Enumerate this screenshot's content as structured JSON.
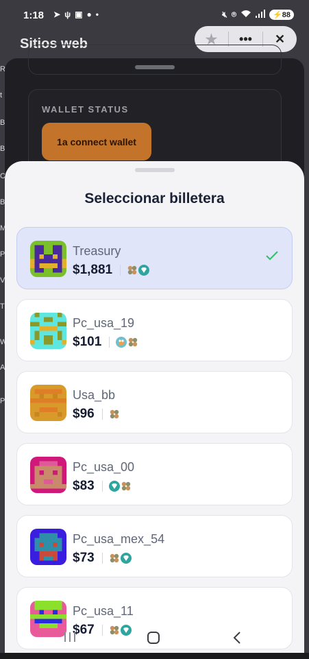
{
  "status_bar": {
    "time": "1:18",
    "battery": "88",
    "left_icons": [
      "location-icon",
      "usb-icon",
      "sim-icon",
      "chat-icon",
      "dot-icon"
    ],
    "right_icons": [
      "mute-icon",
      "location-icon",
      "wifi-icon",
      "signal-icon"
    ]
  },
  "browser": {
    "title": "Sitios web",
    "actions": [
      "star-icon",
      "more-icon",
      "close-icon"
    ]
  },
  "edge_letters": [
    "Re",
    "t",
    "Bo",
    "Ba",
    "Co",
    "Bo",
    "M",
    "Pi",
    "Vi",
    "Tr",
    "W",
    "A",
    "P"
  ],
  "wallet_status": {
    "title": "WALLET STATUS",
    "connect_label": "1a connect wallet",
    "connect_color": "#c4742a"
  },
  "sheet": {
    "title": "Seleccionar billetera",
    "accent": "#e1e5fa",
    "check_color": "#35c06f"
  },
  "wallets": [
    {
      "name": "Treasury",
      "balance": "$1,881",
      "selected": true,
      "chains": [
        "cluster-icon",
        "gem-icon"
      ]
    },
    {
      "name": "Pc_usa_19",
      "balance": "$101",
      "selected": false,
      "chains": [
        "frog-icon",
        "cluster-icon"
      ]
    },
    {
      "name": "Usa_bb",
      "balance": "$96",
      "selected": false,
      "chains": [
        "cluster-icon"
      ]
    },
    {
      "name": "Pc_usa_00",
      "balance": "$83",
      "selected": false,
      "chains": [
        "gem-icon",
        "cluster-icon"
      ]
    },
    {
      "name": "Pc_usa_mex_54",
      "balance": "$73",
      "selected": false,
      "chains": [
        "cluster-icon",
        "gem-icon"
      ]
    },
    {
      "name": "Pc_usa_11",
      "balance": "$67",
      "selected": false,
      "chains": [
        "cluster-icon",
        "gem-icon"
      ]
    }
  ],
  "nav": [
    "recents-icon",
    "home-icon",
    "back-icon"
  ]
}
